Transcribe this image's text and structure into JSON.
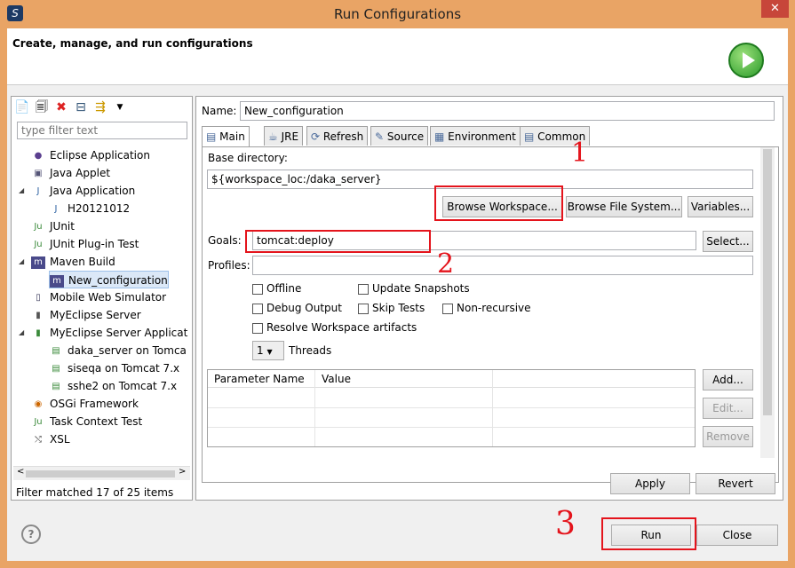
{
  "window": {
    "title": "Run Configurations",
    "close": "✕"
  },
  "banner": {
    "heading": "Create, manage, and run configurations"
  },
  "left": {
    "filter_placeholder": "type filter text",
    "tree": [
      {
        "label": "Eclipse Application",
        "icon": "eclipse-icon",
        "level": 0
      },
      {
        "label": "Java Applet",
        "icon": "applet-icon",
        "level": 0
      },
      {
        "label": "Java Application",
        "icon": "java-app-icon",
        "level": 0,
        "expanded": true
      },
      {
        "label": "H20121012",
        "icon": "java-app-icon",
        "level": 1
      },
      {
        "label": "JUnit",
        "icon": "junit-icon",
        "level": 0
      },
      {
        "label": "JUnit Plug-in Test",
        "icon": "junit-plugin-icon",
        "level": 0
      },
      {
        "label": "Maven Build",
        "icon": "maven-icon",
        "level": 0,
        "expanded": true
      },
      {
        "label": "New_configuration",
        "icon": "maven-icon",
        "level": 1,
        "selected": true
      },
      {
        "label": "Mobile Web Simulator",
        "icon": "mobile-icon",
        "level": 0
      },
      {
        "label": "MyEclipse Server",
        "icon": "server-icon",
        "level": 0
      },
      {
        "label": "MyEclipse Server Applicat",
        "icon": "server-app-icon",
        "level": 0,
        "expanded": true
      },
      {
        "label": "daka_server on Tomca",
        "icon": "tomcat-icon",
        "level": 1
      },
      {
        "label": "siseqa on Tomcat  7.x",
        "icon": "tomcat-icon",
        "level": 1
      },
      {
        "label": "sshe2 on Tomcat  7.x",
        "icon": "tomcat-icon",
        "level": 1
      },
      {
        "label": "OSGi Framework",
        "icon": "osgi-icon",
        "level": 0
      },
      {
        "label": "Task Context Test",
        "icon": "task-icon",
        "level": 0
      },
      {
        "label": "XSL",
        "icon": "xsl-icon",
        "level": 0
      }
    ],
    "status": "Filter matched 17 of 25 items"
  },
  "main": {
    "name_label": "Name:",
    "name_value": "New_configuration",
    "tabs": [
      "Main",
      "JRE",
      "Refresh",
      "Source",
      "Environment",
      "Common"
    ],
    "base_dir_label": "Base directory:",
    "base_dir_value": "${workspace_loc:/daka_server}",
    "browse_workspace": "Browse Workspace...",
    "browse_fs": "Browse File System...",
    "variables": "Variables...",
    "goals_label": "Goals:",
    "goals_value": "tomcat:deploy",
    "select": "Select...",
    "profiles_label": "Profiles:",
    "profiles_value": "",
    "checks": {
      "offline": "Offline",
      "update": "Update Snapshots",
      "debug": "Debug Output",
      "skip": "Skip Tests",
      "nonrec": "Non-recursive",
      "resolve": "Resolve Workspace artifacts"
    },
    "threads_value": "1",
    "threads_label": "Threads",
    "table_headers": [
      "Parameter Name",
      "Value"
    ],
    "add": "Add...",
    "edit": "Edit...",
    "remove": "Remove",
    "apply": "Apply",
    "revert": "Revert"
  },
  "footer": {
    "help": "?",
    "run": "Run",
    "close": "Close"
  },
  "annotations": [
    "1",
    "2",
    "3"
  ]
}
